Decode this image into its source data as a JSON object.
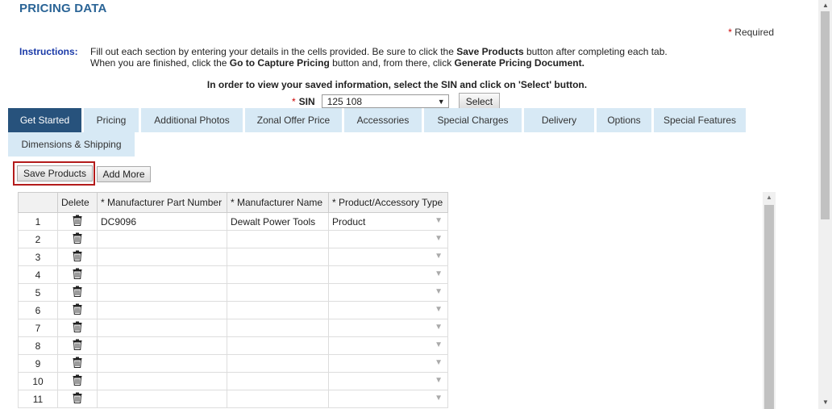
{
  "page": {
    "title": "PRICING DATA",
    "required_star": "*",
    "required_text": "Required"
  },
  "instructions": {
    "label": "Instructions:",
    "line1": {
      "a": "Fill out each section by entering your details in the cells provided. Be sure to click the ",
      "b": "Save Products",
      "c": " button after completing each tab."
    },
    "line2": {
      "a": "When you are finished, click the ",
      "b": "Go to Capture Pricing",
      "c": " button and, from there, click ",
      "d": "Generate Pricing Document."
    }
  },
  "sin": {
    "instruction": "In order to view your saved information, select the SIN and click on 'Select' button.",
    "star": "*",
    "label": "SIN",
    "value": "125 108",
    "select_label": "Select"
  },
  "tabs": [
    {
      "label": "Get Started",
      "active": true
    },
    {
      "label": "Pricing"
    },
    {
      "label": "Additional Photos"
    },
    {
      "label": "Zonal Offer Price"
    },
    {
      "label": "Accessories"
    },
    {
      "label": "Special Charges"
    },
    {
      "label": "Delivery"
    },
    {
      "label": "Options"
    },
    {
      "label": "Special Features"
    },
    {
      "label": "Dimensions & Shipping"
    }
  ],
  "toolbar": {
    "save_label": "Save Products",
    "add_label": "Add More"
  },
  "table": {
    "headers": [
      "",
      "Delete",
      "* Manufacturer Part Number",
      "* Manufacturer Name",
      "* Product/Accessory Type"
    ],
    "rows": [
      {
        "num": "1",
        "part": "DC9096",
        "manufacturer": "Dewalt Power Tools",
        "type": "Product"
      },
      {
        "num": "2",
        "part": "",
        "manufacturer": "",
        "type": ""
      },
      {
        "num": "3",
        "part": "",
        "manufacturer": "",
        "type": ""
      },
      {
        "num": "4",
        "part": "",
        "manufacturer": "",
        "type": ""
      },
      {
        "num": "5",
        "part": "",
        "manufacturer": "",
        "type": ""
      },
      {
        "num": "6",
        "part": "",
        "manufacturer": "",
        "type": ""
      },
      {
        "num": "7",
        "part": "",
        "manufacturer": "",
        "type": ""
      },
      {
        "num": "8",
        "part": "",
        "manufacturer": "",
        "type": ""
      },
      {
        "num": "9",
        "part": "",
        "manufacturer": "",
        "type": ""
      },
      {
        "num": "10",
        "part": "",
        "manufacturer": "",
        "type": ""
      },
      {
        "num": "11",
        "part": "",
        "manufacturer": "",
        "type": ""
      }
    ]
  },
  "icons": {
    "trash": "trash-icon",
    "dropdown": "chevron-down-icon"
  },
  "colors": {
    "title": "#2a6496",
    "instructions_label": "#1a3aa8",
    "tab_active": "#27527c",
    "tab_inactive": "#d7e9f5",
    "highlight": "#b31b1b"
  }
}
